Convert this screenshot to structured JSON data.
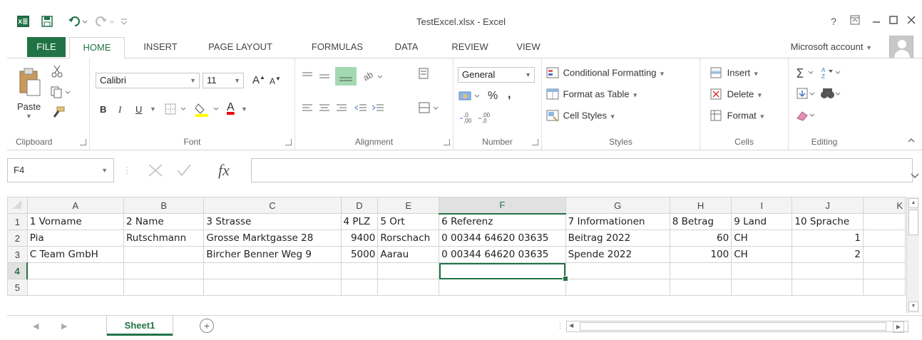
{
  "window": {
    "title": "TestExcel.xlsx - Excel",
    "help": "?",
    "logo_text": "x≣"
  },
  "tabs": [
    "FILE",
    "HOME",
    "INSERT",
    "PAGE LAYOUT",
    "FORMULAS",
    "DATA",
    "REVIEW",
    "VIEW"
  ],
  "account_label": "Microsoft account",
  "ribbon": {
    "clipboard": {
      "paste": "Paste",
      "label": "Clipboard"
    },
    "font": {
      "name": "Calibri",
      "size": "11",
      "grow": "A",
      "shrink": "A",
      "bold": "B",
      "italic": "I",
      "underline": "U",
      "color_letter": "A",
      "label": "Font"
    },
    "alignment": {
      "label": "Alignment"
    },
    "number": {
      "format": "General",
      "percent": "%",
      "comma": ",",
      "label": "Number"
    },
    "styles": {
      "conditional": "Conditional Formatting",
      "format_table": "Format as Table",
      "cell_styles": "Cell Styles",
      "label": "Styles"
    },
    "cells": {
      "insert": "Insert",
      "delete": "Delete",
      "format": "Format",
      "label": "Cells"
    },
    "editing": {
      "label": "Editing"
    }
  },
  "formula_bar": {
    "name_box": "F4",
    "fx": "fx",
    "value": ""
  },
  "sheet": {
    "columns": [
      "A",
      "B",
      "C",
      "D",
      "E",
      "F",
      "G",
      "H",
      "I",
      "J",
      "K"
    ],
    "rows": [
      {
        "n": "1",
        "cells": [
          "1 Vorname",
          "2 Name",
          "3 Strasse",
          "4 PLZ",
          "5 Ort",
          "6 Referenz",
          "7 Informationen",
          "8 Betrag",
          "9 Land",
          "10 Sprache",
          ""
        ]
      },
      {
        "n": "2",
        "cells": [
          "Pia",
          "Rutschmann",
          "Grosse Marktgasse 28",
          "9400",
          "Rorschach",
          "0 00344 64620 03635",
          "Beitrag 2022",
          "60",
          "CH",
          "1",
          ""
        ]
      },
      {
        "n": "3",
        "cells": [
          "C Team GmbH",
          "",
          "Bircher Benner Weg 9",
          "5000",
          "Aarau",
          "0 00344 64620 03635",
          "Spende 2022",
          "100",
          "CH",
          "2",
          ""
        ]
      },
      {
        "n": "4",
        "cells": [
          "",
          "",
          "",
          "",
          "",
          "",
          "",
          "",
          "",
          "",
          ""
        ]
      },
      {
        "n": "5",
        "cells": [
          "",
          "",
          "",
          "",
          "",
          "",
          "",
          "",
          "",
          "",
          ""
        ]
      }
    ],
    "active_cell": "F4",
    "tab_name": "Sheet1",
    "add_sheet": "+"
  }
}
